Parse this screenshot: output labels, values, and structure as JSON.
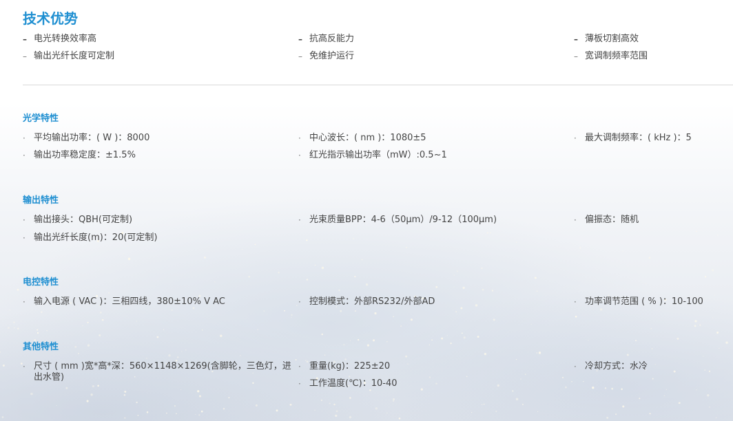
{
  "page_title": "技术优势",
  "advantages": {
    "col1": [
      "电光转换效率高",
      "输出光纤长度可定制"
    ],
    "col2": [
      "抗高反能力",
      "免维护运行"
    ],
    "col3": [
      "薄板切割高效",
      "宽调制频率范围"
    ]
  },
  "sections": {
    "optical": {
      "title": "光学特性",
      "col1": [
        "平均输出功率：( W )：8000",
        "输出功率稳定度：±1.5%"
      ],
      "col2": [
        "中心波长：( nm )：1080±5",
        "红光指示输出功率（mW）:0.5~1"
      ],
      "col3": [
        "最大调制频率：( kHz )：5"
      ]
    },
    "output": {
      "title": "输出特性",
      "col1": [
        "输出接头：QBH(可定制)",
        "输出光纤长度(m)：20(可定制)"
      ],
      "col2": [
        "光束质量BPP：4-6（50μm）/9-12（100μm)"
      ],
      "col3": [
        "偏振态：随机"
      ]
    },
    "electrical": {
      "title": "电控特性",
      "col1": [
        "输入电源 ( VAC )：三相四线，380±10% V AC"
      ],
      "col2": [
        "控制模式：外部RS232/外部AD"
      ],
      "col3": [
        "功率调节范围 ( % )：10-100"
      ]
    },
    "other": {
      "title": "其他特性",
      "col1": [
        "尺寸 ( mm )宽*高*深：560×1148×1269(含脚轮，三色灯，进出水管)"
      ],
      "col2": [
        "重量(kg)：225±20",
        "工作温度(℃)：10-40"
      ],
      "col3": [
        "冷却方式：水冷"
      ]
    }
  },
  "bullets": {
    "dash": "–",
    "dot": "·"
  },
  "colors": {
    "accent": "#1f8fd1",
    "text": "#444444",
    "divider": "#d9d9d9"
  }
}
